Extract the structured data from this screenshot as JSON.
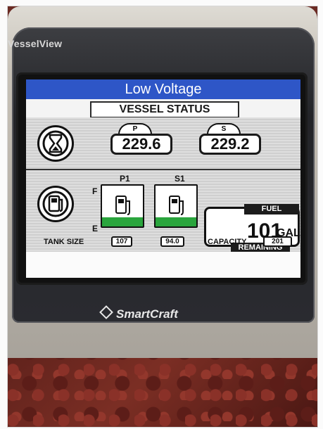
{
  "device": {
    "brand": "VesselView",
    "footer_brand": "SmartCraft",
    "footer_icon": "diamond-icon"
  },
  "screen": {
    "title": "Low Voltage",
    "subtitle": "VESSEL STATUS"
  },
  "voltage": {
    "left_label": "P",
    "left_value": "229.6",
    "right_label": "S",
    "right_value": "229.2",
    "icon": "hourglass-icon"
  },
  "fuel": {
    "icon": "fuel-pump-icon",
    "full_marker": "F",
    "empty_marker": "E",
    "tanks": [
      {
        "label": "P1",
        "size": "107",
        "level_fraction": 0.22
      },
      {
        "label": "S1",
        "size": "94.0",
        "level_fraction": 0.22
      }
    ],
    "tank_size_label": "TANK SIZE",
    "fuel_label": "FUEL",
    "remaining_value": "101",
    "remaining_unit": "GAL",
    "remaining_label": "REMAINING",
    "capacity_label": "CAPACITY",
    "capacity_value": "201"
  },
  "colors": {
    "title_bar": "#2E56C7",
    "tank_fill": "#2AA53D"
  }
}
